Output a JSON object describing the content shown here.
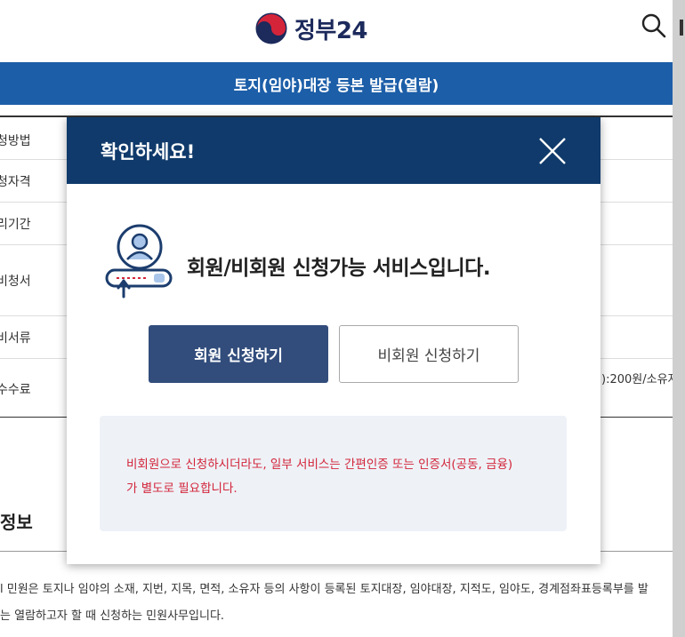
{
  "header": {
    "logo_text": "정부24",
    "search_icon": "search-icon"
  },
  "page": {
    "title": "토지(임야)대장 등본 발급(열람)",
    "table_labels": [
      "청방법",
      "청자격",
      "리기간",
      "비청서",
      "비서류",
      "수수료"
    ],
    "fee_value": "):200원/소유자",
    "section_title": "정보",
    "description_lines": [
      "l 민원은 토지나 임야의 소재, 지번, 지목, 면적, 소유자 등의 사항이 등록된 토지대장, 임야대장, 지적도, 임야도, 경계점좌표등록부를 발",
      "는 열람하고자 할 때 신청하는 민원사무입니다."
    ]
  },
  "modal": {
    "title": "확인하세요!",
    "close_icon": "close-icon",
    "message": "회원/비회원 신청가능 서비스입니다.",
    "member_button": "회원 신청하기",
    "guest_button": "비회원 신청하기",
    "notice_lines": [
      "비회원으로 신청하시더라도, 일부 서비스는 간편인증 또는 인증서(공동, 금융)",
      "가 별도로 필요합니다."
    ]
  },
  "colors": {
    "title_bar": "#1c5ea8",
    "modal_header": "#0f3a6b",
    "member_button": "#324d7c",
    "notice_text": "#d3243a",
    "notice_bg": "#eef2f7"
  }
}
